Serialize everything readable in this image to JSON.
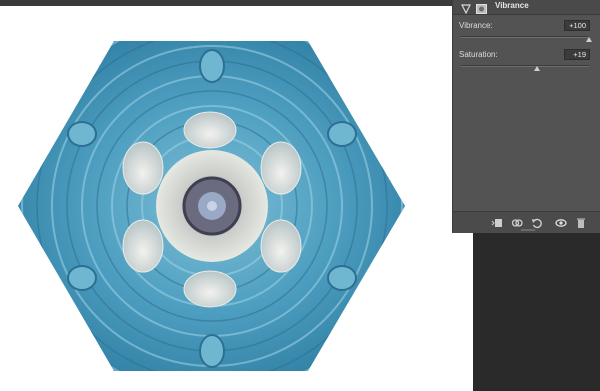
{
  "panel": {
    "title": "Vibrance"
  },
  "adjustments": {
    "vibrance": {
      "label": "Vibrance:",
      "value": "+100",
      "level": 1.0
    },
    "saturation": {
      "label": "Saturation:",
      "value": "+19",
      "level": 0.595
    }
  },
  "footer_icons": [
    "clip-to-layer-icon",
    "toggle-view-previous-icon",
    "reset-icon",
    "visibility-eye-icon",
    "delete-trash-icon"
  ],
  "colors": {
    "panel_bg": "#535353",
    "canvas_bg": "#ffffff",
    "workspace_dark": "#2a2a2a",
    "kaleidoscope_blue": "#4a9bbd"
  }
}
